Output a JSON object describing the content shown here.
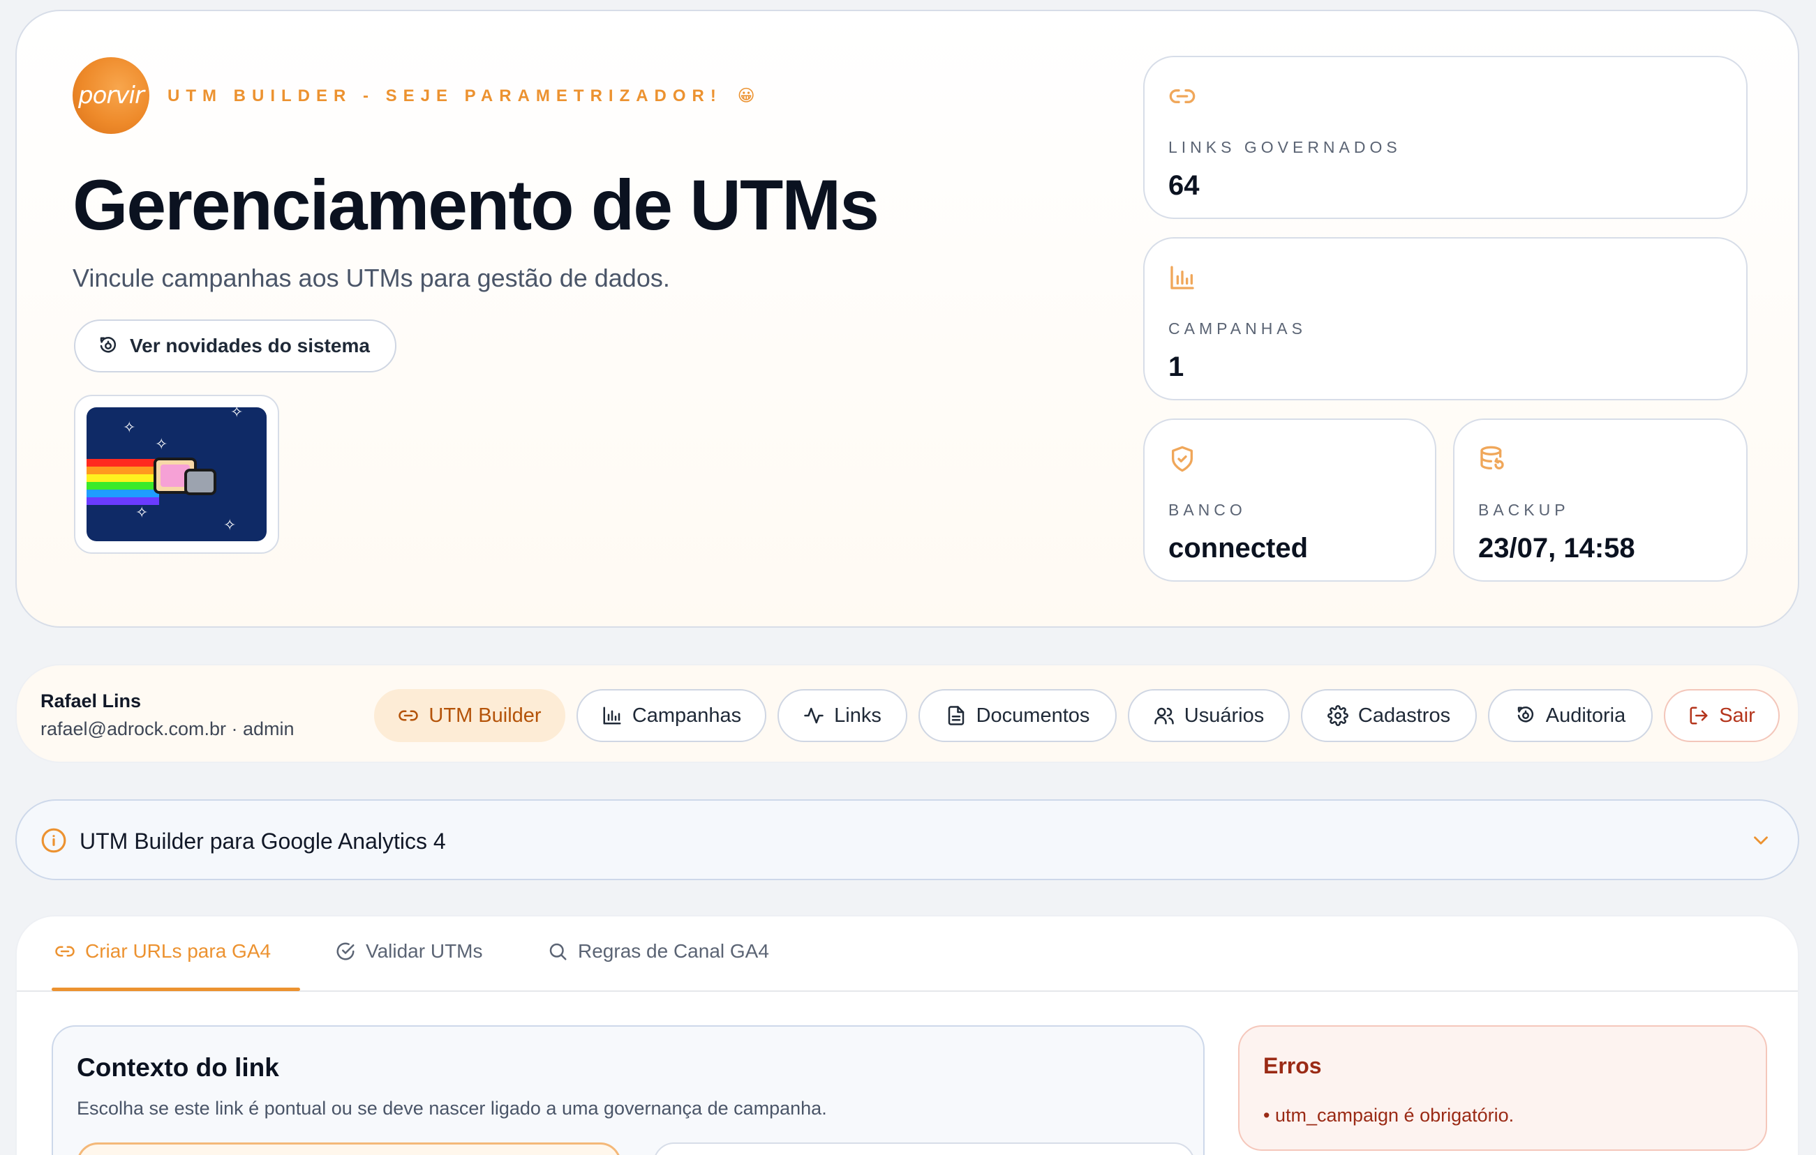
{
  "hero": {
    "logo_text": "porvir",
    "tagline": "UTM BUILDER - SEJE PARAMETRIZADOR!",
    "tagline_emoji": "😀",
    "title": "Gerenciamento de UTMs",
    "subtitle": "Vincule campanhas aos UTMs para gestão de dados.",
    "news_button": "Ver novidades do sistema"
  },
  "stats": {
    "links": {
      "label": "LINKS GOVERNADOS",
      "value": "64",
      "icon": "link-icon"
    },
    "campaigns": {
      "label": "CAMPANHAS",
      "value": "1",
      "icon": "bar-chart-icon"
    },
    "database": {
      "label": "BANCO",
      "value": "connected",
      "icon": "shield-check-icon"
    },
    "backup": {
      "label": "BACKUP",
      "value": "23/07, 14:58",
      "icon": "database-restore-icon"
    }
  },
  "user": {
    "name": "Rafael Lins",
    "meta": "rafael@adrock.com.br · admin"
  },
  "nav": {
    "utm_builder": "UTM Builder",
    "campaigns": "Campanhas",
    "links": "Links",
    "documents": "Documentos",
    "users": "Usuários",
    "registers": "Cadastros",
    "audit": "Auditoria",
    "logout": "Sair"
  },
  "accordion": {
    "title": "UTM Builder para Google Analytics 4"
  },
  "tabs": {
    "create": "Criar URLs para GA4",
    "validate": "Validar UTMs",
    "rules": "Regras de Canal GA4"
  },
  "context": {
    "title": "Contexto do link",
    "description": "Escolha se este link é pontual ou se deve nascer ligado a uma governança de campanha."
  },
  "errors": {
    "title": "Erros",
    "items": [
      "• utm_campaign é obrigatório."
    ]
  },
  "colors": {
    "accent": "#ec9230",
    "error": "#9a2a15",
    "text": "#0b1220"
  }
}
